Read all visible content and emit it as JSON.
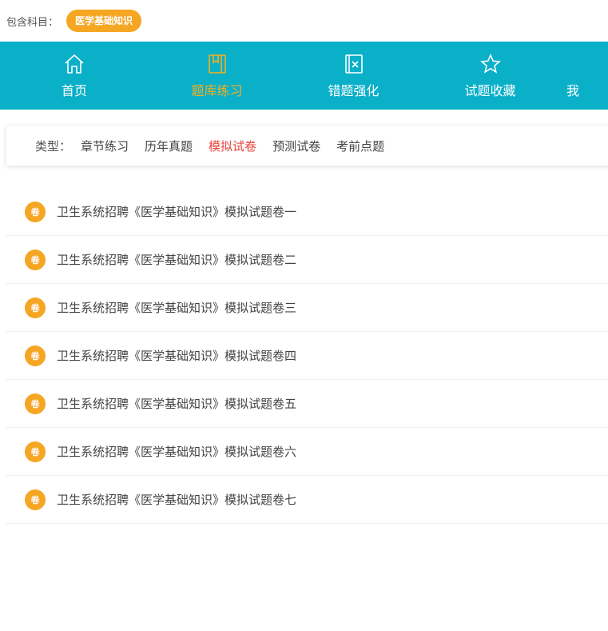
{
  "topbar": {
    "label": "包含科目：",
    "subject": "医学基础知识"
  },
  "nav": {
    "items": [
      {
        "label": "首页",
        "icon": "home-icon"
      },
      {
        "label": "题库练习",
        "icon": "book-icon",
        "active": true
      },
      {
        "label": "错题强化",
        "icon": "error-book-icon"
      },
      {
        "label": "试题收藏",
        "icon": "star-icon"
      },
      {
        "label": "我",
        "icon": "user-icon"
      }
    ],
    "colors": {
      "bg": "#0aafc8",
      "active": "#f5b120",
      "text": "#ffffff"
    }
  },
  "filter": {
    "label": "类型：",
    "options": [
      "章节练习",
      "历年真题",
      "模拟试卷",
      "预测试卷",
      "考前点题"
    ],
    "selected": "模拟试卷"
  },
  "papers": {
    "badge": "卷",
    "items": [
      "卫生系统招聘《医学基础知识》模拟试题卷一",
      "卫生系统招聘《医学基础知识》模拟试题卷二",
      "卫生系统招聘《医学基础知识》模拟试题卷三",
      "卫生系统招聘《医学基础知识》模拟试题卷四",
      "卫生系统招聘《医学基础知识》模拟试题卷五",
      "卫生系统招聘《医学基础知识》模拟试题卷六",
      "卫生系统招聘《医学基础知识》模拟试题卷七"
    ]
  }
}
